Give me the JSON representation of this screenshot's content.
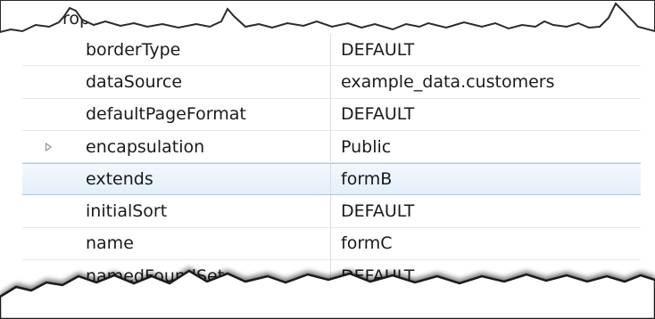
{
  "header": {
    "partial_label": "rop"
  },
  "properties": [
    {
      "name": "borderType",
      "value": "DEFAULT",
      "expandable": false,
      "selected": false
    },
    {
      "name": "dataSource",
      "value": "example_data.customers",
      "expandable": false,
      "selected": false
    },
    {
      "name": "defaultPageFormat",
      "value": "DEFAULT",
      "expandable": false,
      "selected": false
    },
    {
      "name": "encapsulation",
      "value": "Public",
      "expandable": true,
      "selected": false
    },
    {
      "name": "extends",
      "value": "formB",
      "expandable": false,
      "selected": true
    },
    {
      "name": "initialSort",
      "value": "DEFAULT",
      "expandable": false,
      "selected": false
    },
    {
      "name": "name",
      "value": "formC",
      "expandable": false,
      "selected": false
    },
    {
      "name": "namedFoundSet",
      "value": "DEFAULT",
      "expandable": false,
      "selected": false
    }
  ],
  "colors": {
    "selection_border": "#a9c7ea",
    "selection_fill": "#e4effb",
    "twisty": "#8a8a8a"
  }
}
